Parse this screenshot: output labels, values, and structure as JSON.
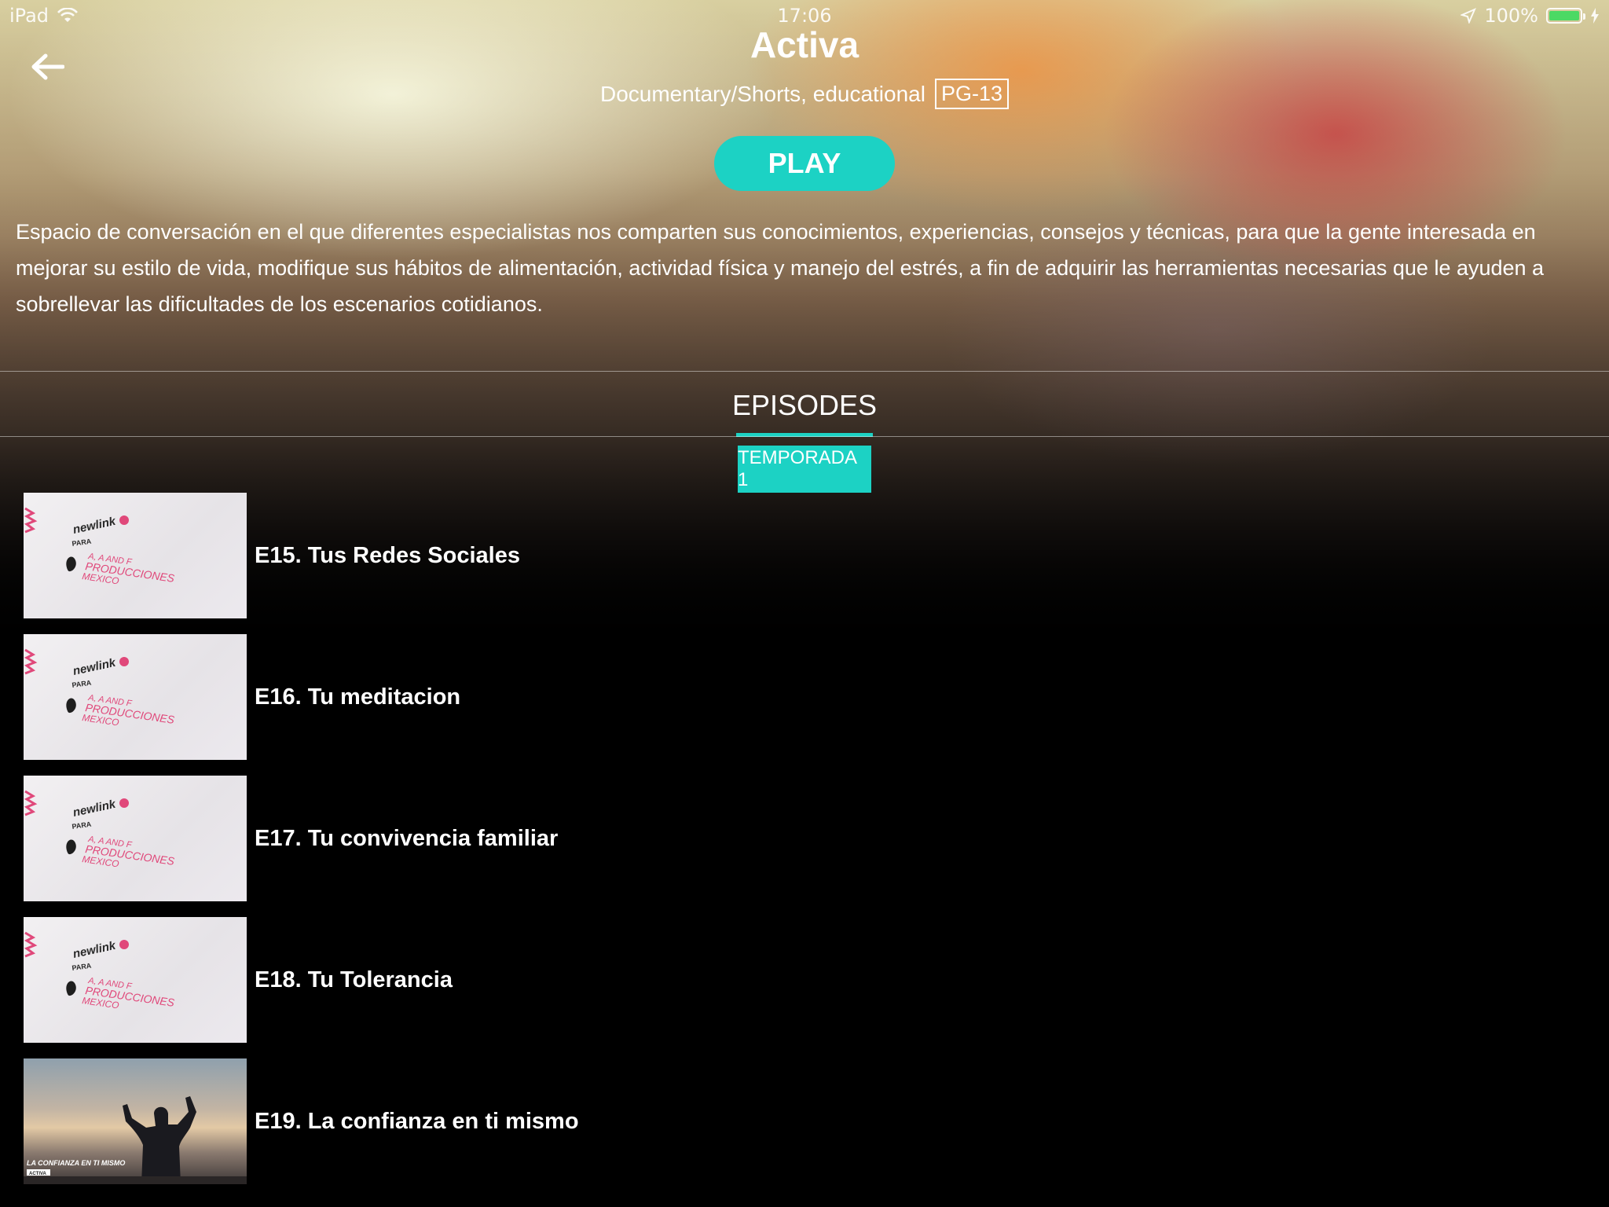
{
  "status_bar": {
    "device": "iPad",
    "time": "17:06",
    "battery": "100%"
  },
  "header": {
    "back_icon": "arrow-left-icon",
    "title": "Activa",
    "genres": "Documentary/Shorts, educational",
    "rating": "PG-13",
    "play_label": "PLAY"
  },
  "description": "Espacio de conversación en el que diferentes especialistas nos comparten sus conocimientos, experiencias, consejos y técnicas, para que la gente interesada en mejorar su estilo de vida, modifique sus hábitos de alimentación, actividad física y manejo del estrés, a fin de adquirir las herramientas necesarias que le ayuden a sobrellevar las dificultades de los escenarios cotidianos.",
  "tabs": {
    "episodes_label": "EPISODES",
    "season_label": "TEMPORADA 1"
  },
  "thumbnail_text": {
    "brand": "newlink",
    "para": "PARA",
    "line1": "A, A AND F",
    "line2": "PRODUCCIONES",
    "line3": "MEXICO",
    "photo_caption": "LA CONFIANZA EN TI MISMO",
    "photo_badge": "ACTIVA"
  },
  "episodes": [
    {
      "title": "E15. Tus Redes Sociales",
      "thumb": "logo"
    },
    {
      "title": "E16. Tu meditacion",
      "thumb": "logo"
    },
    {
      "title": "E17. Tu convivencia familiar",
      "thumb": "logo"
    },
    {
      "title": "E18. Tu Tolerancia",
      "thumb": "logo"
    },
    {
      "title": "E19. La confianza en ti mismo",
      "thumb": "photo"
    }
  ],
  "colors": {
    "accent": "#1cd2c4",
    "background": "#000000",
    "battery": "#4cd964",
    "logo_pink": "#e0487a"
  }
}
